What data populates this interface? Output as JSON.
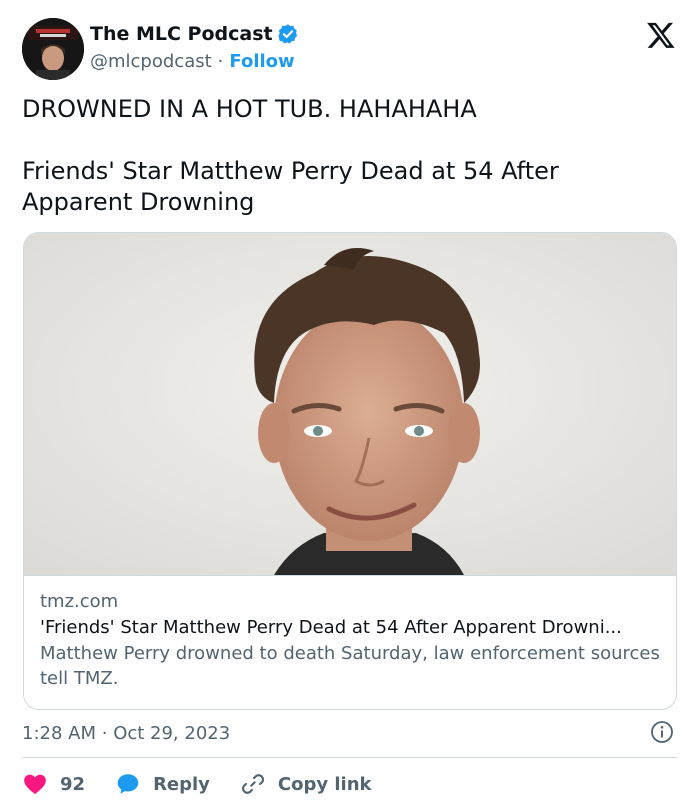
{
  "author": {
    "display_name": "The MLC Podcast",
    "handle": "@mlcpodcast",
    "separator": "·",
    "follow_label": "Follow"
  },
  "tweet": {
    "line1": "DROWNED IN A HOT TUB. HAHAHAHA",
    "line2": "Friends' Star Matthew Perry Dead at 54 After Apparent Drowning"
  },
  "card": {
    "domain": "tmz.com",
    "title": "'Friends' Star Matthew Perry Dead at 54 After Apparent Drowni...",
    "description": "Matthew Perry drowned to death Saturday, law enforcement sources tell TMZ."
  },
  "meta": {
    "time": "1:28 AM",
    "separator": "·",
    "date": "Oct 29, 2023"
  },
  "actions": {
    "like_count": "92",
    "reply_label": "Reply",
    "copy_link_label": "Copy link"
  },
  "colors": {
    "accent": "#1d9bf0",
    "like": "#f91880",
    "text": "#0f1419",
    "muted": "#536471",
    "border": "#cfd9de"
  },
  "icons": [
    "verified-badge-icon",
    "x-logo-icon",
    "info-icon",
    "heart-icon",
    "reply-bubble-icon",
    "link-icon"
  ]
}
